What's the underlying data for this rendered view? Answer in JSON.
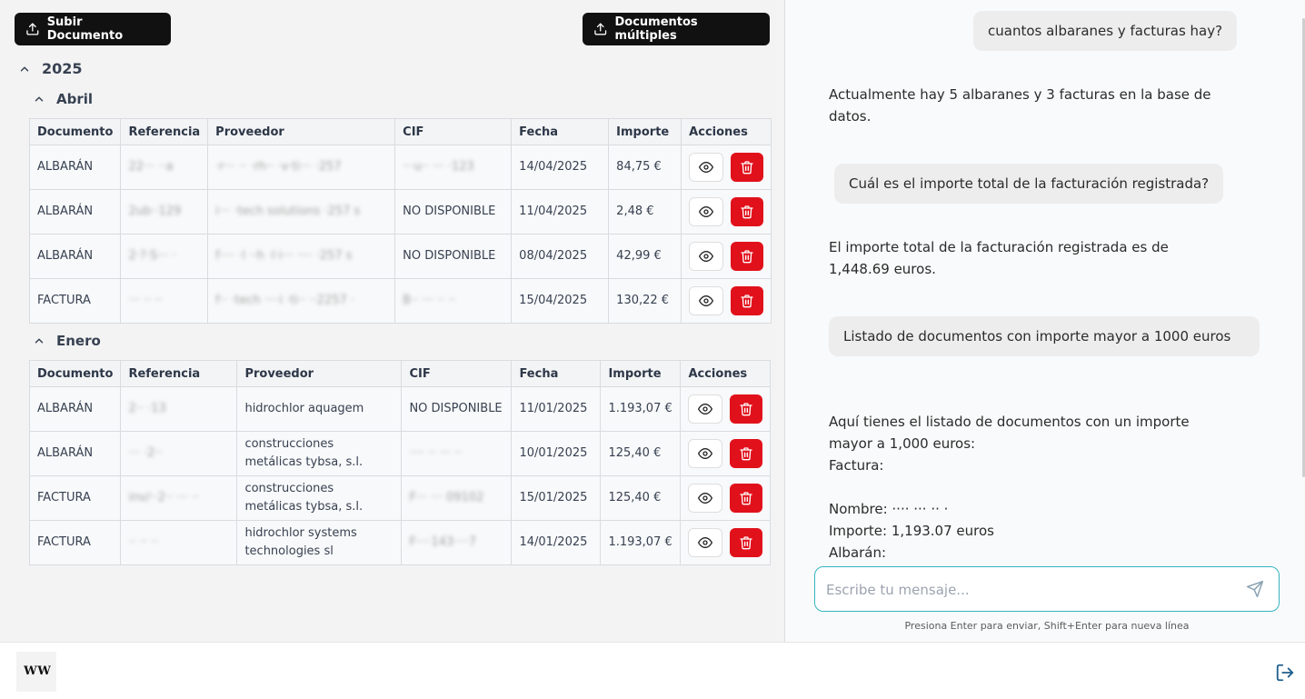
{
  "toolbar": {
    "upload_label": "Subir Documento",
    "multi_label": "Documentos múltiples"
  },
  "year": "2025",
  "columns_april": [
    "Documento",
    "Referencia",
    "Proveedor",
    "CIF",
    "Fecha",
    "Importe",
    "Acciones"
  ],
  "columns_january": [
    "Documento",
    "Referencia",
    "Proveedor",
    "CIF",
    "Fecha",
    "Importe",
    "Acciones"
  ],
  "months": [
    {
      "name": "Abril",
      "rows": [
        {
          "doc": "ALBARÁN",
          "ref": "22··· ··a",
          "prov": "·r··· ·· ·rh·· ·v·ti··· ·257",
          "cif": "···u·· ··· ·123",
          "fecha": "14/04/2025",
          "importe": "84,75 €"
        },
        {
          "doc": "ALBARÁN",
          "ref": "2ub··129",
          "prov": "i··· ·tech solutions ·257 s",
          "cif": "NO DISPONIBLE",
          "fecha": "11/04/2025",
          "importe": "2,48 €"
        },
        {
          "doc": "ALBARÁN",
          "ref": "2·?·S··· ·",
          "prov": "f···· ·l ··h ·l·i··· ···· ·257 s",
          "cif": "NO DISPONIBLE",
          "fecha": "08/04/2025",
          "importe": "42,99 €"
        },
        {
          "doc": "FACTURA",
          "ref": "··· ·· ··",
          "prov": "f·· ·tech ····i ·ti·· ··2257 ·",
          "cif": "B·· ··· ·· ··",
          "fecha": "15/04/2025",
          "importe": "130,22 €"
        }
      ]
    },
    {
      "name": "Enero",
      "rows": [
        {
          "doc": "ALBARÁN",
          "ref": "2·· ·13",
          "prov": "hidrochlor aquagem",
          "cif": "NO DISPONIBLE",
          "fecha": "11/01/2025",
          "importe": "1.193,07 €"
        },
        {
          "doc": "ALBARÁN",
          "ref": "··· ·2··",
          "prov": "construcciones metálicas tybsa, s.l.",
          "cif": "···· ·· ··· ··",
          "fecha": "10/01/2025",
          "importe": "125,40 €"
        },
        {
          "doc": "FACTURA",
          "ref": "inv/··2·· ··· ··",
          "prov": "construcciones metálicas tybsa, s.l.",
          "cif": "F··· ··· 09102",
          "fecha": "15/01/2025",
          "importe": "125,40 €"
        },
        {
          "doc": "FACTURA",
          "ref": "·· ·· ··",
          "prov": "hidrochlor systems technologies sl",
          "cif": "F····143····7",
          "fecha": "14/01/2025",
          "importe": "1.193,07 €"
        }
      ]
    }
  ],
  "chat": {
    "messages": [
      {
        "role": "user",
        "text": "cuantos albaranes y facturas hay?"
      },
      {
        "role": "bot",
        "text": "Actualmente hay 5 albaranes y 3 facturas en la base de datos."
      },
      {
        "role": "user",
        "text": "Cuál es el importe total de la facturación registrada?"
      },
      {
        "role": "bot",
        "text": "El importe total de la facturación registrada es de 1,448.69 euros."
      },
      {
        "role": "user",
        "text": "Listado de documentos con importe mayor a 1000 euros"
      },
      {
        "role": "bot",
        "lines": [
          "Aquí tienes el listado de documentos con un importe mayor a 1,000 euros:",
          "Factura:",
          "",
          "Nombre: ···· ··· ·· ·",
          "Importe: 1,193.07 euros",
          "Albarán:"
        ]
      }
    ],
    "input_placeholder": "Escribe tu mensaje...",
    "hint": "Presiona Enter para enviar, Shift+Enter para nueva línea"
  },
  "footer": {
    "logo_text": "W W"
  },
  "icons": {
    "upload": "upload-icon",
    "chevron": "chevron-up-icon",
    "view": "eye-icon",
    "delete": "trash-icon",
    "send": "send-icon",
    "logout": "logout-icon"
  },
  "colors": {
    "doc_green": "#16a34a",
    "delete_red": "#e1111b",
    "input_border": "#36b4c0",
    "dark_button": "#111111"
  }
}
